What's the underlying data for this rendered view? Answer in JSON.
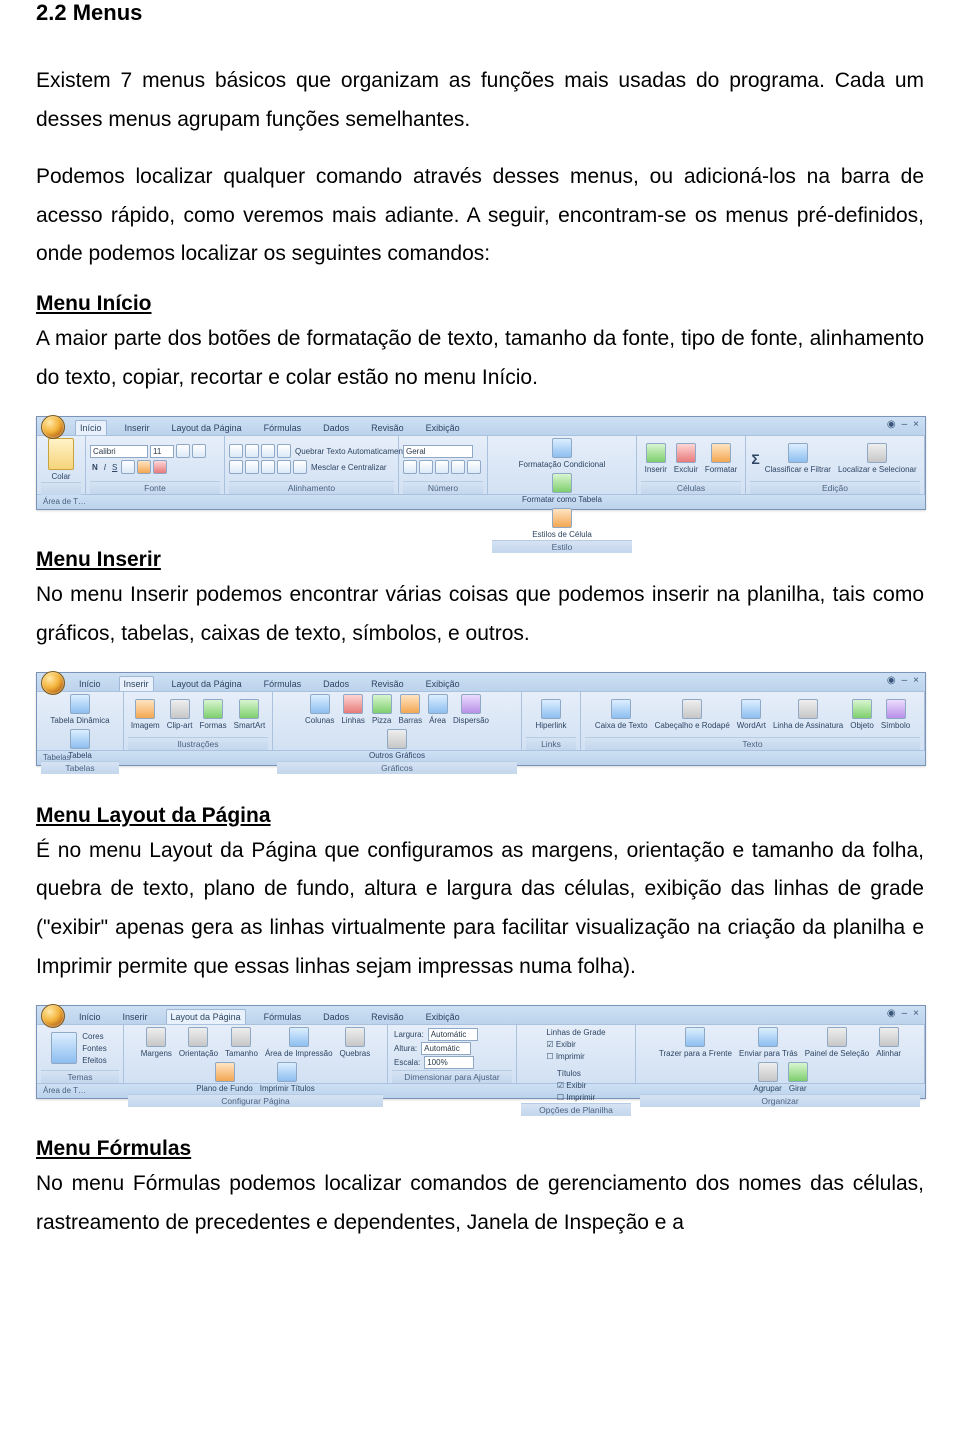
{
  "section_title": "2.2 Menus",
  "intro_p1": "Existem 7 menus básicos que organizam as funções mais usadas do programa. Cada um desses menus agrupam funções semelhantes.",
  "intro_p2": "Podemos localizar qualquer comando através desses menus, ou adicioná-los na barra de acesso rápido, como veremos mais adiante. A seguir, encontram-se os menus pré-definidos, onde podemos localizar os seguintes comandos:",
  "menu_inicio": {
    "heading": "Menu Início",
    "text": "A maior parte dos botões de formatação de texto, tamanho da fonte, tipo de fonte, alinhamento do texto, copiar, recortar e colar estão no menu Início."
  },
  "menu_inserir": {
    "heading": "Menu Inserir",
    "text": "No menu Inserir podemos encontrar várias coisas que podemos inserir na planilha, tais como gráficos, tabelas, caixas de texto, símbolos, e outros."
  },
  "menu_layout": {
    "heading": "Menu Layout da Página",
    "text": "É no menu Layout da Página que configuramos as margens, orientação e tamanho da folha, quebra de texto, plano de fundo, altura e largura das células, exibição das linhas de grade (\"exibir\" apenas gera as linhas virtualmente para facilitar visualização na criação da planilha e Imprimir permite que essas linhas sejam impressas numa folha)."
  },
  "menu_formulas": {
    "heading": "Menu Fórmulas",
    "text": "No menu Fórmulas podemos localizar comandos de gerenciamento dos nomes das células, rastreamento de precedentes e dependentes, Janela de Inspeção e a"
  },
  "ribbon_tabs": [
    "Início",
    "Inserir",
    "Layout da Página",
    "Fórmulas",
    "Dados",
    "Revisão",
    "Exibição"
  ],
  "ribbon_inicio": {
    "active_tab": "Início",
    "footer": "Área de T…",
    "groups": [
      {
        "label": "",
        "items": [
          "Colar"
        ]
      },
      {
        "label": "Fonte",
        "font_name": "Calibri",
        "font_size": "11",
        "bold": "N",
        "italic": "I",
        "sstrike": "S"
      },
      {
        "label": "Alinhamento",
        "wrap": "Quebrar Texto Automaticamente",
        "merge": "Mesclar e Centralizar"
      },
      {
        "label": "Número",
        "format": "Geral"
      },
      {
        "label": "Estilo",
        "items": [
          "Formatação Condicional",
          "Formatar como Tabela",
          "Estilos de Célula"
        ]
      },
      {
        "label": "Células",
        "items": [
          "Inserir",
          "Excluir",
          "Formatar"
        ]
      },
      {
        "label": "Edição",
        "items": [
          "Classificar e Filtrar",
          "Localizar e Selecionar"
        ]
      }
    ]
  },
  "ribbon_inserir": {
    "active_tab": "Inserir",
    "footer": "Tabelas",
    "groups": [
      {
        "label": "Tabelas",
        "items": [
          "Tabela Dinâmica",
          "Tabela"
        ]
      },
      {
        "label": "Ilustrações",
        "items": [
          "Imagem",
          "Clip-art",
          "Formas",
          "SmartArt"
        ]
      },
      {
        "label": "Gráficos",
        "items": [
          "Colunas",
          "Linhas",
          "Pizza",
          "Barras",
          "Área",
          "Dispersão",
          "Outros Gráficos"
        ]
      },
      {
        "label": "Links",
        "items": [
          "Hiperlink"
        ]
      },
      {
        "label": "Texto",
        "items": [
          "Caixa de Texto",
          "Cabeçalho e Rodapé",
          "WordArt",
          "Linha de Assinatura",
          "Objeto",
          "Símbolo"
        ]
      }
    ]
  },
  "ribbon_layout": {
    "active_tab": "Layout da Página",
    "footer": "Área de T…",
    "groups": [
      {
        "label": "Temas",
        "items": [
          "Temas",
          "Cores",
          "Fontes",
          "Efeitos"
        ]
      },
      {
        "label": "Configurar Página",
        "items": [
          "Margens",
          "Orientação",
          "Tamanho",
          "Área de Impressão",
          "Quebras",
          "Plano de Fundo",
          "Imprimir Títulos"
        ]
      },
      {
        "label": "Dimensionar para Ajustar",
        "largura": "Largura:",
        "altura": "Altura:",
        "escala": "Escala:",
        "auto": "Automátic",
        "scale_val": "100%"
      },
      {
        "label": "Opções de Planilha",
        "grid": "Linhas de Grade",
        "titles": "Títulos",
        "exibir": "Exibir",
        "imprimir": "Imprimir"
      },
      {
        "label": "Organizar",
        "items": [
          "Trazer para a Frente",
          "Enviar para Trás",
          "Painel de Seleção",
          "Alinhar",
          "Agrupar",
          "Girar"
        ]
      }
    ]
  }
}
